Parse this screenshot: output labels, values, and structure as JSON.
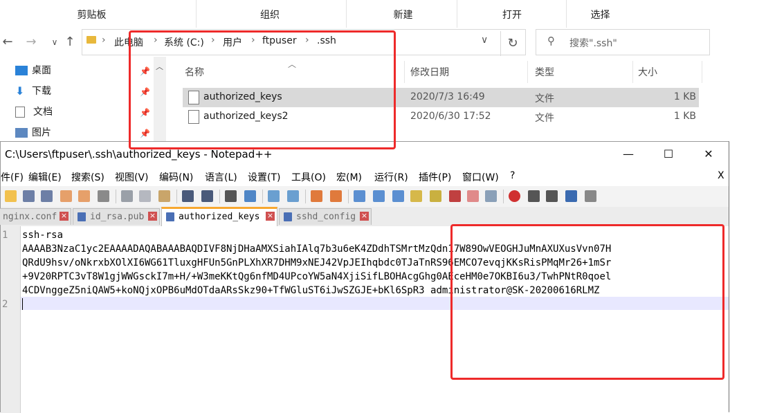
{
  "explorer": {
    "ribbon_groups": [
      "剪贴板",
      "组织",
      "新建",
      "打开",
      "选择"
    ],
    "breadcrumb": [
      "此电脑",
      "系统 (C:)",
      "用户",
      "ftpuser",
      ".ssh"
    ],
    "search_placeholder": "搜索\".ssh\"",
    "nav_items": [
      "桌面",
      "下载",
      "文档",
      "图片"
    ],
    "columns": {
      "name": "名称",
      "date": "修改日期",
      "type": "类型",
      "size": "大小"
    },
    "files": [
      {
        "name": "authorized_keys",
        "date": "2020/7/3 16:49",
        "type": "文件",
        "size": "1 KB",
        "selected": true
      },
      {
        "name": "authorized_keys2",
        "date": "2020/6/30 17:52",
        "type": "文件",
        "size": "1 KB",
        "selected": false
      }
    ]
  },
  "notepad": {
    "title": "C:\\Users\\ftpuser\\.ssh\\authorized_keys - Notepad++",
    "menu": [
      "件(F)",
      "编辑(E)",
      "搜索(S)",
      "视图(V)",
      "编码(N)",
      "语言(L)",
      "设置(T)",
      "工具(O)",
      "宏(M)",
      "运行(R)",
      "插件(P)",
      "窗口(W)",
      "?"
    ],
    "menu_close": "X",
    "tabs": [
      {
        "label": "nginx.conf",
        "active": false
      },
      {
        "label": "id_rsa.pub",
        "active": false
      },
      {
        "label": "authorized_keys",
        "active": true
      },
      {
        "label": "sshd_config",
        "active": false
      }
    ],
    "line_numbers": [
      "1",
      "2"
    ],
    "code_lines": [
      "ssh-rsa",
      "AAAAB3NzaC1yc2EAAAADAQABAAABAQDIVF8NjDHaAMXSiahIAlq7b3u6eK4ZDdhTSMrtMzQdn17W89OwVEOGHJuMnAXUXusVvn07H",
      "QRdU9hsv/oNkrxbXOlXI6WG61TluxgHFUn5GnPLXhXR7DHM9xNEJ42VpJEIhqbdc0TJaTnRS96EMCO7evqjKKsRisPMqMr26+1mSr",
      "+9V20RPTC3vT8W1gjWWGsckI7m+H/+W3meKKtQg6nfMD4UPcoYW5aN4XjiSifLBOHAcgGhg0AEceHM0e7OKBI6u3/TwhPNtR0qoel",
      "4CDVnggeZ5niQAW5+koNQjxOPB6uMdOTdaARsSkz90+TfWGluST6iJwSZGJE+bKl6SpR3 administrator@SK-20200616RLMZ"
    ]
  },
  "colors": {
    "highlight_box": "#ee2a2a",
    "active_tab_accent": "#f7a830",
    "folder": "#e8b83c"
  }
}
